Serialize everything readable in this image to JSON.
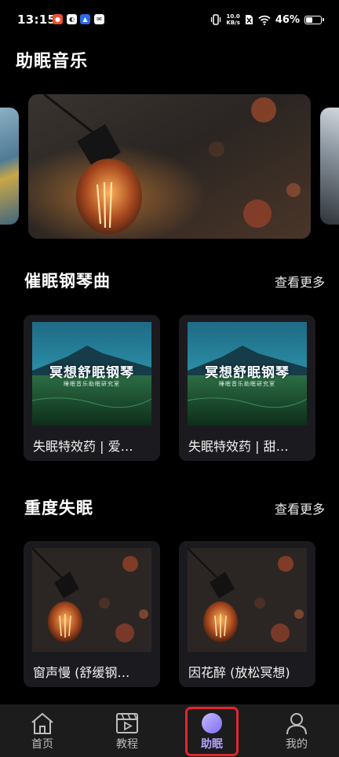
{
  "status_bar": {
    "time": "13:15",
    "net_speed_value": "10.0",
    "net_speed_unit": "KB/s",
    "battery_percent": "46%",
    "battery_level": 0.46
  },
  "page_title": "助眠音乐",
  "sections": [
    {
      "title": "催眠钢琴曲",
      "more_label": "查看更多",
      "cards": [
        {
          "cover_title": "冥想舒眠钢琴",
          "cover_subtitle": "睡眠音乐助眠研究室",
          "title": "失眠特效药 | 爱…"
        },
        {
          "cover_title": "冥想舒眠钢琴",
          "cover_subtitle": "睡眠音乐助眠研究室",
          "title": "失眠特效药 | 甜…"
        }
      ]
    },
    {
      "title": "重度失眠",
      "more_label": "查看更多",
      "cards": [
        {
          "title": "窗声慢 (舒缓钢…"
        },
        {
          "title": "因花醉 (放松冥想)"
        }
      ]
    }
  ],
  "bottom_nav": [
    {
      "label": "首页",
      "icon": "home-icon",
      "active": false
    },
    {
      "label": "教程",
      "icon": "video-icon",
      "active": false
    },
    {
      "label": "助眠",
      "icon": "moon-icon",
      "active": true
    },
    {
      "label": "我的",
      "icon": "user-icon",
      "active": false
    }
  ],
  "colors": {
    "background": "#000000",
    "card_background": "#1b1b1f",
    "nav_background": "#1c1c1c",
    "active_accent": "#b6a3ff",
    "highlight_border": "#e4252f"
  }
}
